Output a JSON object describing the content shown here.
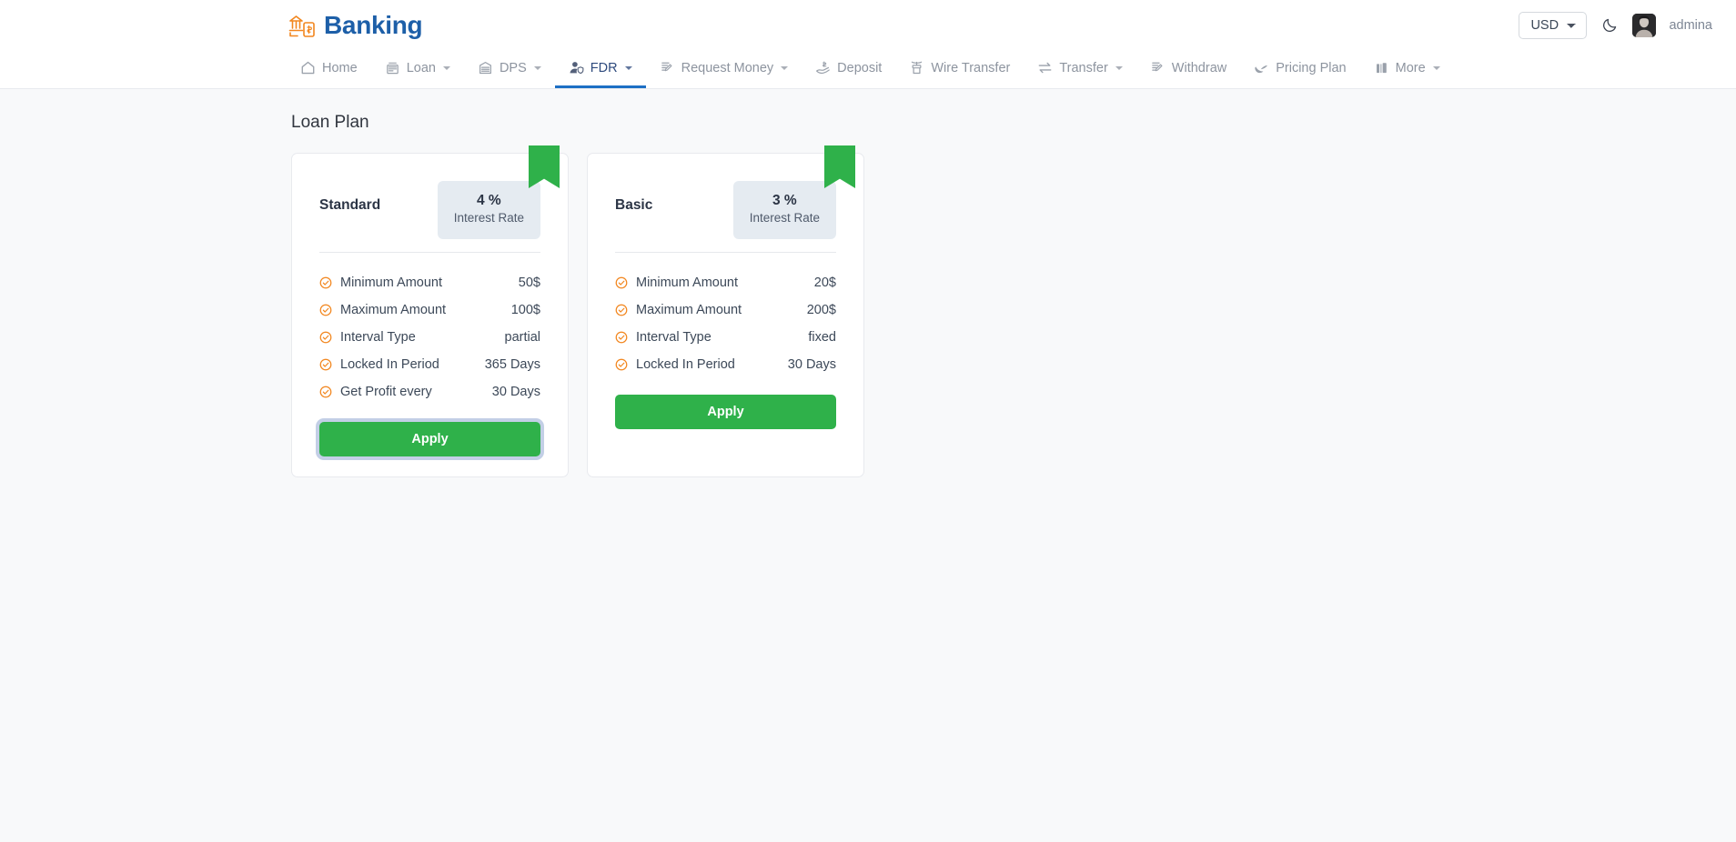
{
  "brand": {
    "text": "Banking",
    "icon": "bank-phone-icon",
    "color": "#1d5fa8"
  },
  "topbar": {
    "currency": {
      "selected": "USD",
      "options": [
        "USD"
      ]
    },
    "theme_toggle_icon": "moon-icon",
    "avatar_icon": "user-avatar",
    "username": "admina"
  },
  "nav": {
    "items": [
      {
        "label": "Home",
        "icon": "home-icon",
        "caret": false,
        "active": false
      },
      {
        "label": "Loan",
        "icon": "loan-icon",
        "caret": true,
        "active": false
      },
      {
        "label": "DPS",
        "icon": "dps-bank-icon",
        "caret": true,
        "active": false
      },
      {
        "label": "FDR",
        "icon": "user-shield-icon",
        "caret": true,
        "active": true
      },
      {
        "label": "Request Money",
        "icon": "request-money-icon",
        "caret": true,
        "active": false
      },
      {
        "label": "Deposit",
        "icon": "deposit-hand-icon",
        "caret": false,
        "active": false
      },
      {
        "label": "Wire Transfer",
        "icon": "wire-transfer-icon",
        "caret": false,
        "active": false
      },
      {
        "label": "Transfer",
        "icon": "transfer-arrows-icon",
        "caret": true,
        "active": false
      },
      {
        "label": "Withdraw",
        "icon": "withdraw-icon",
        "caret": false,
        "active": false
      },
      {
        "label": "Pricing Plan",
        "icon": "pricing-plan-icon",
        "caret": false,
        "active": false
      },
      {
        "label": "More",
        "icon": "more-briefcase-icon",
        "caret": true,
        "active": false
      }
    ]
  },
  "main": {
    "page_title": "Loan Plan",
    "cards": [
      {
        "name": "Standard",
        "rate_value": "4 %",
        "rate_label": "Interest Rate",
        "ribbon_color": "#2fb14a",
        "apply_label": "Apply",
        "focused": true,
        "features": [
          {
            "label": "Minimum Amount",
            "value": "50$"
          },
          {
            "label": "Maximum Amount",
            "value": "100$"
          },
          {
            "label": "Interval Type",
            "value": "partial"
          },
          {
            "label": "Locked In Period",
            "value": "365 Days"
          },
          {
            "label": "Get Profit every",
            "value": "30 Days"
          }
        ]
      },
      {
        "name": "Basic",
        "rate_value": "3 %",
        "rate_label": "Interest Rate",
        "ribbon_color": "#2fb14a",
        "apply_label": "Apply",
        "focused": false,
        "features": [
          {
            "label": "Minimum Amount",
            "value": "20$"
          },
          {
            "label": "Maximum Amount",
            "value": "200$"
          },
          {
            "label": "Interval Type",
            "value": "fixed"
          },
          {
            "label": "Locked In Period",
            "value": "30 Days"
          }
        ]
      }
    ]
  }
}
